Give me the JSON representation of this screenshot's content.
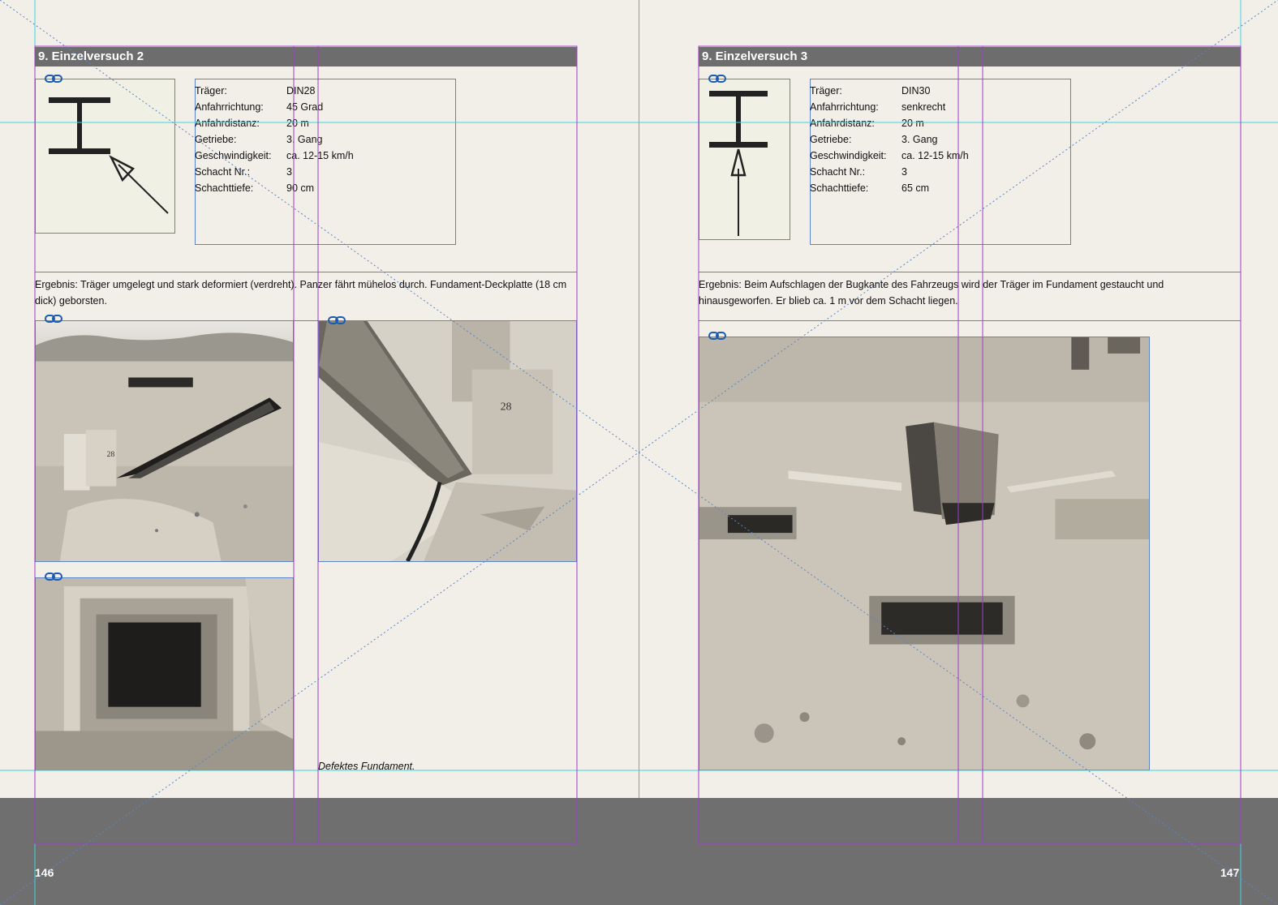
{
  "left_page": {
    "title": "9. Einzelversuch 2",
    "specs": [
      {
        "key": "Träger:",
        "value": "DIN28"
      },
      {
        "key": "Anfahrrichtung:",
        "value": "45 Grad"
      },
      {
        "key": "Anfahrdistanz:",
        "value": "20 m"
      },
      {
        "key": "Getriebe:",
        "value": "3. Gang"
      },
      {
        "key": "Geschwindigkeit:",
        "value": "ca. 12-15 km/h"
      },
      {
        "key": "Schacht Nr.:",
        "value": "3"
      },
      {
        "key": "Schachttiefe:",
        "value": "90 cm"
      }
    ],
    "result": "Ergebnis: Träger umgelegt und stark deformiert (verdreht). Panzer fährt mühelos durch. Fundament-Deckplatte (18 cm dick) geborsten.",
    "caption": "Defektes Fundament.",
    "page_number": "146"
  },
  "right_page": {
    "title": "9. Einzelversuch 3",
    "specs": [
      {
        "key": "Träger:",
        "value": "DIN30"
      },
      {
        "key": "Anfahrrichtung:",
        "value": "senkrecht"
      },
      {
        "key": "Anfahrdistanz:",
        "value": "20 m"
      },
      {
        "key": "Getriebe:",
        "value": "3. Gang"
      },
      {
        "key": "Geschwindigkeit:",
        "value": "ca. 12-15 km/h"
      },
      {
        "key": "Schacht Nr.:",
        "value": "3"
      },
      {
        "key": "Schachttiefe:",
        "value": "65 cm"
      }
    ],
    "result": "Ergebnis: Beim Aufschlagen der Bugkante des Fahrzeugs wird der Träger im Fundament gestaucht und hinausgeworfen. Er blieb ca. 1 m vor dem Schacht liegen.",
    "page_number": "147"
  },
  "photo_labels": {
    "post_number": "28"
  },
  "colors": {
    "paper": "#f2eee8",
    "header_bar": "#6d6d6d",
    "frame_blue": "#5d84c6",
    "guide_magenta": "#a23cc8",
    "guide_cyan": "#3fd4e0"
  }
}
